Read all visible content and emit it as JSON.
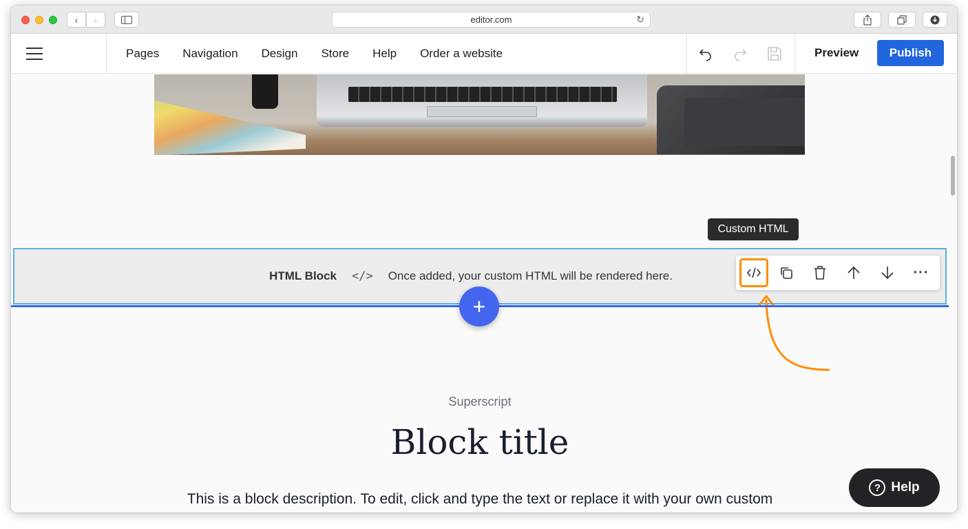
{
  "browser": {
    "url": "editor.com"
  },
  "toolbar": {
    "menu": [
      "Pages",
      "Navigation",
      "Design",
      "Store",
      "Help",
      "Order a website"
    ],
    "preview_label": "Preview",
    "publish_label": "Publish"
  },
  "html_block": {
    "title": "HTML Block",
    "code_symbol": "</>",
    "placeholder_text": "Once added, your custom HTML will be rendered here."
  },
  "block_toolbar": {
    "tooltip": "Custom HTML",
    "more_label": "···"
  },
  "block": {
    "superscript": "Superscript",
    "title": "Block title",
    "description": "This is a block description. To edit, click and type the text or replace it with your own custom"
  },
  "help": {
    "label": "Help",
    "icon_glyph": "?"
  },
  "colors": {
    "publish": "#2266dd",
    "add_button": "#4466ee",
    "highlight": "#ff8c00",
    "block_outline": "#5ab0e0"
  }
}
